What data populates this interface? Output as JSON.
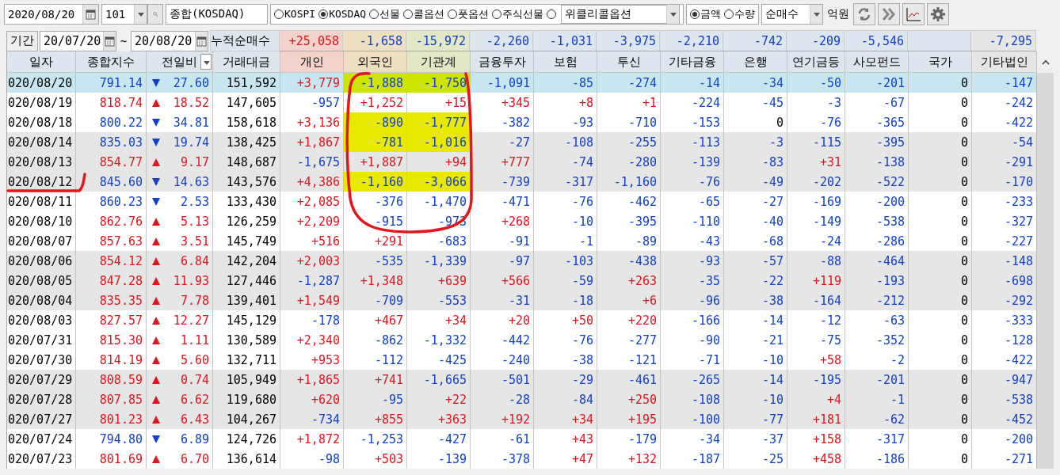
{
  "toolbar": {
    "date": "2020/08/20",
    "code": "101",
    "name": "종합(KOSDAQ)",
    "markets": [
      {
        "label": "KOSPI",
        "selected": false
      },
      {
        "label": "KOSDAQ",
        "selected": true
      },
      {
        "label": "선물",
        "selected": false
      },
      {
        "label": "콜옵션",
        "selected": false
      },
      {
        "label": "풋옵션",
        "selected": false
      },
      {
        "label": "주식선물",
        "selected": false
      }
    ],
    "weekly": {
      "selected": false,
      "value": "위클리콜옵션"
    },
    "units": [
      {
        "label": "금액",
        "selected": true
      },
      {
        "label": "수량",
        "selected": false
      }
    ],
    "mode": "순매수",
    "unit_label": "억원"
  },
  "summary": {
    "period_button": "기간",
    "from": "20/07/20",
    "separator": "~",
    "to": "20/08/20",
    "label": "누적순매수",
    "values": [
      {
        "kind": "total",
        "value": "+25,058"
      },
      {
        "kind": "total",
        "value": "-1,658"
      },
      {
        "kind": "total",
        "value": "-15,972"
      },
      {
        "kind": "total",
        "value": "-2,260"
      },
      {
        "kind": "total",
        "value": "-1,031"
      },
      {
        "kind": "total",
        "value": "-3,975"
      },
      {
        "kind": "total",
        "value": "-2,210"
      },
      {
        "kind": "total",
        "value": "-742"
      },
      {
        "kind": "total",
        "value": "-209"
      },
      {
        "kind": "total",
        "value": "-5,546"
      },
      {
        "kind": "blank"
      },
      {
        "kind": "total",
        "value": "-7,295"
      }
    ]
  },
  "table": {
    "columns": [
      {
        "label": "일자",
        "kind": "plain"
      },
      {
        "label": "종합지수",
        "kind": "plain"
      },
      {
        "label": "전일비",
        "kind": "dropdown"
      },
      {
        "label": "거래대금",
        "kind": "plain"
      },
      {
        "label": "개인",
        "kind": "plain"
      },
      {
        "label": "외국인",
        "kind": "plain"
      },
      {
        "label": "기관계",
        "kind": "plain"
      },
      {
        "label": "금융투자",
        "kind": "plain"
      },
      {
        "label": "보험",
        "kind": "plain"
      },
      {
        "label": "투신",
        "kind": "plain"
      },
      {
        "label": "기타금융",
        "kind": "plain"
      },
      {
        "label": "은행",
        "kind": "plain"
      },
      {
        "label": "연기금등",
        "kind": "plain"
      },
      {
        "label": "사모펀드",
        "kind": "plain"
      },
      {
        "label": "국가",
        "kind": "plain"
      },
      {
        "label": "기타법인",
        "kind": "plain"
      }
    ],
    "rows": [
      {
        "selected": true,
        "highlighted": true,
        "rising": false,
        "cells": [
          "020/08/20",
          "791.14",
          "27.60",
          "151,592",
          "+3,779",
          "-1,888",
          "-1,750",
          "-1,091",
          "-85",
          "-274",
          "-14",
          "-34",
          "-50",
          "-201",
          "0",
          "-147"
        ]
      },
      {
        "selected": false,
        "highlighted": false,
        "rising": true,
        "cells": [
          "020/08/19",
          "818.74",
          "18.52",
          "147,605",
          "-957",
          "+1,252",
          "+15",
          "+345",
          "+8",
          "+1",
          "-224",
          "-45",
          "-3",
          "-67",
          "0",
          "-242"
        ]
      },
      {
        "selected": false,
        "highlighted": true,
        "rising": false,
        "cells": [
          "020/08/18",
          "800.22",
          "34.81",
          "158,618",
          "+3,136",
          "-890",
          "-1,777",
          "-382",
          "-93",
          "-710",
          "-153",
          "0",
          "-76",
          "-365",
          "0",
          "-422"
        ]
      },
      {
        "selected": false,
        "highlighted": true,
        "rising": false,
        "cells": [
          "020/08/14",
          "835.03",
          "19.74",
          "138,425",
          "+1,867",
          "-781",
          "-1,016",
          "-27",
          "-108",
          "-255",
          "-113",
          "-3",
          "-115",
          "-395",
          "0",
          "-54"
        ]
      },
      {
        "selected": false,
        "highlighted": false,
        "rising": true,
        "cells": [
          "020/08/13",
          "854.77",
          "9.17",
          "148,687",
          "-1,675",
          "+1,887",
          "+94",
          "+777",
          "-74",
          "-280",
          "-139",
          "-83",
          "+31",
          "-138",
          "0",
          "-291"
        ]
      },
      {
        "selected": false,
        "highlighted": true,
        "rising": false,
        "cells": [
          "020/08/12",
          "845.60",
          "14.63",
          "143,576",
          "+4,386",
          "-1,160",
          "-3,066",
          "-739",
          "-317",
          "-1,160",
          "-76",
          "-49",
          "-202",
          "-522",
          "0",
          "-170"
        ]
      },
      {
        "selected": false,
        "highlighted": false,
        "rising": false,
        "cells": [
          "020/08/11",
          "860.23",
          "2.53",
          "133,430",
          "+2,085",
          "-376",
          "-1,470",
          "-471",
          "-76",
          "-462",
          "-65",
          "-27",
          "-169",
          "-200",
          "0",
          "-233"
        ]
      },
      {
        "selected": false,
        "highlighted": false,
        "rising": true,
        "cells": [
          "020/08/10",
          "862.76",
          "5.13",
          "126,259",
          "+2,209",
          "-915",
          "-973",
          "+268",
          "-10",
          "-395",
          "-110",
          "-40",
          "-149",
          "-538",
          "0",
          "-327"
        ]
      },
      {
        "selected": false,
        "highlighted": false,
        "rising": true,
        "cells": [
          "020/08/07",
          "857.63",
          "3.51",
          "145,749",
          "+516",
          "+291",
          "-683",
          "-91",
          "-1",
          "-89",
          "-43",
          "-68",
          "-24",
          "-286",
          "0",
          "-227"
        ]
      },
      {
        "selected": false,
        "highlighted": false,
        "rising": true,
        "cells": [
          "020/08/06",
          "854.12",
          "6.84",
          "142,204",
          "+2,003",
          "-535",
          "-1,339",
          "-97",
          "-103",
          "-438",
          "-93",
          "-57",
          "-88",
          "-464",
          "0",
          "-148"
        ]
      },
      {
        "selected": false,
        "highlighted": false,
        "rising": true,
        "cells": [
          "020/08/05",
          "847.28",
          "11.93",
          "127,446",
          "-1,287",
          "+1,348",
          "+639",
          "+566",
          "-59",
          "+263",
          "-35",
          "-22",
          "+119",
          "-193",
          "0",
          "-698"
        ]
      },
      {
        "selected": false,
        "highlighted": false,
        "rising": true,
        "cells": [
          "020/08/04",
          "835.35",
          "7.78",
          "139,401",
          "+1,549",
          "-709",
          "-553",
          "-31",
          "-18",
          "+6",
          "-96",
          "-38",
          "-164",
          "-212",
          "0",
          "-292"
        ]
      },
      {
        "selected": false,
        "highlighted": false,
        "rising": true,
        "cells": [
          "020/08/03",
          "827.57",
          "12.27",
          "145,129",
          "-178",
          "+467",
          "+34",
          "+20",
          "+50",
          "+220",
          "-166",
          "-14",
          "-12",
          "-63",
          "0",
          "-333"
        ]
      },
      {
        "selected": false,
        "highlighted": false,
        "rising": true,
        "cells": [
          "020/07/31",
          "815.30",
          "1.11",
          "130,589",
          "+2,340",
          "-862",
          "-1,332",
          "-442",
          "-76",
          "-277",
          "-90",
          "-21",
          "-75",
          "-352",
          "0",
          "-128"
        ]
      },
      {
        "selected": false,
        "highlighted": false,
        "rising": true,
        "cells": [
          "020/07/30",
          "814.19",
          "5.60",
          "132,711",
          "+953",
          "-112",
          "-425",
          "-240",
          "-38",
          "-121",
          "-71",
          "-10",
          "+58",
          "-2",
          "0",
          "-422"
        ]
      },
      {
        "selected": false,
        "highlighted": false,
        "rising": true,
        "cells": [
          "020/07/29",
          "808.59",
          "0.74",
          "105,949",
          "+1,865",
          "+741",
          "-1,665",
          "-501",
          "-29",
          "-461",
          "-265",
          "-14",
          "-195",
          "-201",
          "0",
          "-947"
        ]
      },
      {
        "selected": false,
        "highlighted": false,
        "rising": true,
        "cells": [
          "020/07/28",
          "807.85",
          "6.62",
          "119,680",
          "+620",
          "-95",
          "+22",
          "-28",
          "-84",
          "+250",
          "-108",
          "-10",
          "+4",
          "-1",
          "0",
          "-538"
        ]
      },
      {
        "selected": false,
        "highlighted": false,
        "rising": true,
        "cells": [
          "020/07/27",
          "801.23",
          "6.43",
          "104,267",
          "-734",
          "+855",
          "+363",
          "+192",
          "+34",
          "+195",
          "-100",
          "-77",
          "+181",
          "-62",
          "0",
          "-452"
        ]
      },
      {
        "selected": false,
        "highlighted": false,
        "rising": false,
        "cells": [
          "020/07/24",
          "794.80",
          "6.89",
          "124,726",
          "+1,872",
          "-1,253",
          "-427",
          "-61",
          "+43",
          "-179",
          "-34",
          "-37",
          "+158",
          "-317",
          "0",
          "-200"
        ]
      },
      {
        "selected": false,
        "highlighted": false,
        "rising": true,
        "cells": [
          "020/07/23",
          "801.69",
          "6.70",
          "136,614",
          "-98",
          "+503",
          "-139",
          "-378",
          "+47",
          "+132",
          "-187",
          "-25",
          "+458",
          "-186",
          "0",
          "-271"
        ]
      }
    ]
  }
}
